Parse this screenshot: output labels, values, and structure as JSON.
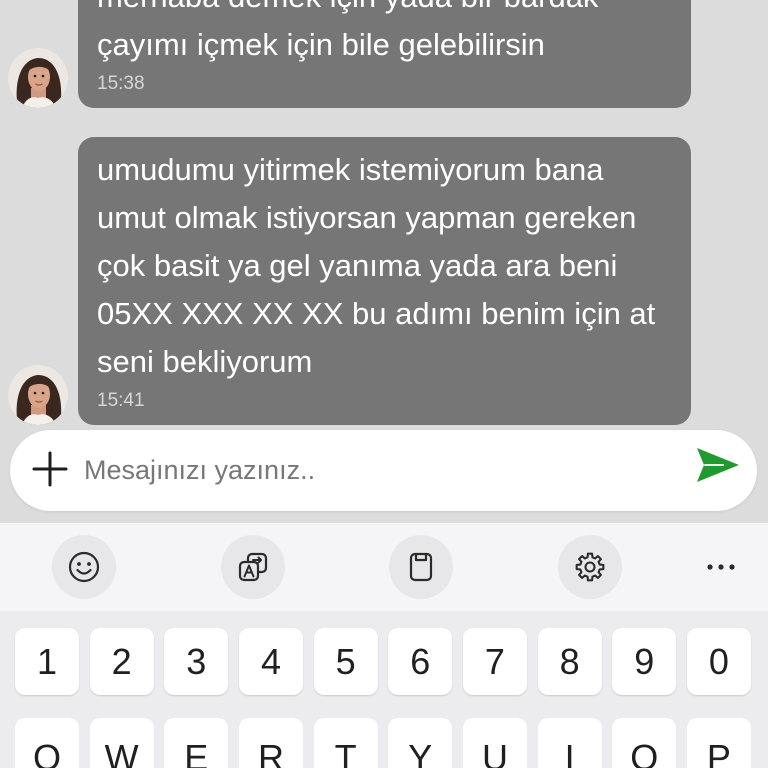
{
  "colors": {
    "chat_background": "#dcdcdc",
    "bubble": "#767676",
    "bubble_text": "#ffffff",
    "time_text": "#d6d6d6",
    "send_accent": "#1e9a2e",
    "keyboard_background": "#ececee",
    "toolbar_background": "#f5f5f7",
    "key": "#ffffff"
  },
  "messages": [
    {
      "lines": [
        "merhaba demek için yada bir bardak",
        "çayımı içmek için bile gelebilirsin"
      ],
      "time": "15:38"
    },
    {
      "lines": [
        "umudumu yitirmek istemiyorum bana",
        "umut olmak istiyorsan yapman gereken",
        "çok basit ya gel yanıma yada ara beni",
        "05XX XXX XX XX bu adımı benim için at",
        "seni bekliyorum"
      ],
      "time": "15:41"
    }
  ],
  "composer": {
    "attach_icon": "plus-icon",
    "placeholder": "Mesajınızı yazınız..",
    "send_icon": "send-icon"
  },
  "keyboard": {
    "toolbar_icons": [
      "emoji-icon",
      "translate-icon",
      "clipboard-icon",
      "gear-icon",
      "more-icon"
    ],
    "number_row": [
      "1",
      "2",
      "3",
      "4",
      "5",
      "6",
      "7",
      "8",
      "9",
      "0"
    ],
    "letter_row": [
      "Q",
      "W",
      "E",
      "R",
      "T",
      "Y",
      "U",
      "I",
      "O",
      "P"
    ]
  }
}
